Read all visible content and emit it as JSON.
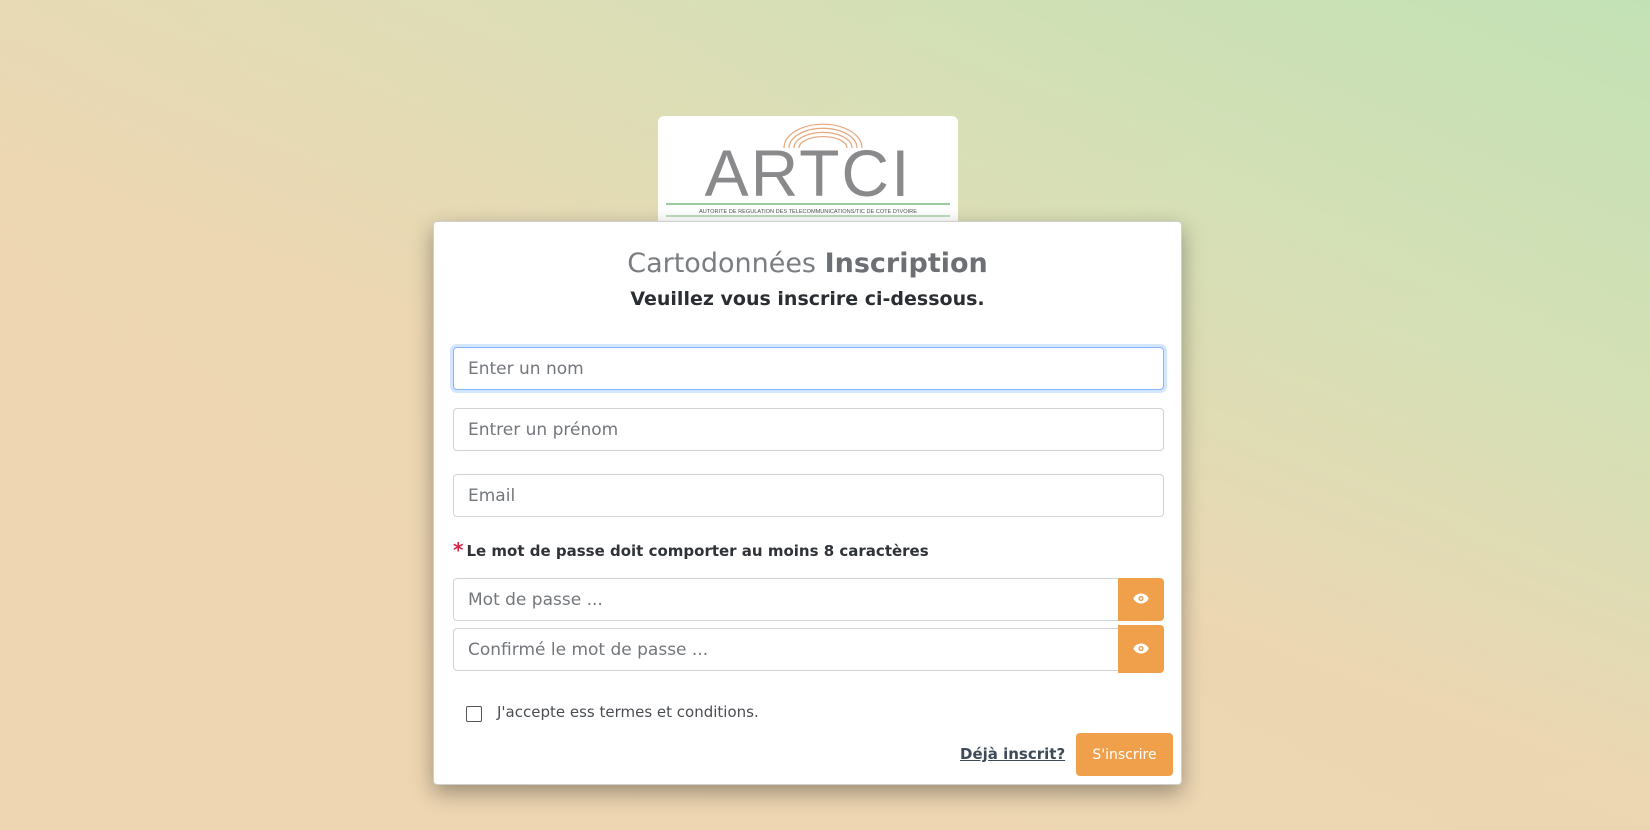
{
  "logo": {
    "text": "ARTCI",
    "tagline": "AUTORITE DE REGULATION DES TELECOMMUNICATIONS/TIC DE COTE D'IVOIRE"
  },
  "header": {
    "title_light": "Cartodonnées",
    "title_bold": "Inscription",
    "subtitle": "Veuillez vous inscrire ci-dessous."
  },
  "form": {
    "name_placeholder": "Enter un nom",
    "firstname_placeholder": "Entrer un prénom",
    "email_placeholder": "Email",
    "password_note_marker": "*",
    "password_note": "Le mot de passe doit comporter au moins 8 caractères",
    "password_placeholder": "Mot de passe ...",
    "confirm_placeholder": "Confirmé le mot de passe ...",
    "show_password_icon": "eye-icon",
    "terms_label": "J'accepte ess termes et conditions.",
    "terms_checked": false,
    "login_link": "Déjà inscrit?",
    "submit_label": "S'inscrire"
  },
  "colors": {
    "accent": "#f0a04b",
    "required_marker": "#d1264a",
    "focus_border": "#86b7fe"
  }
}
